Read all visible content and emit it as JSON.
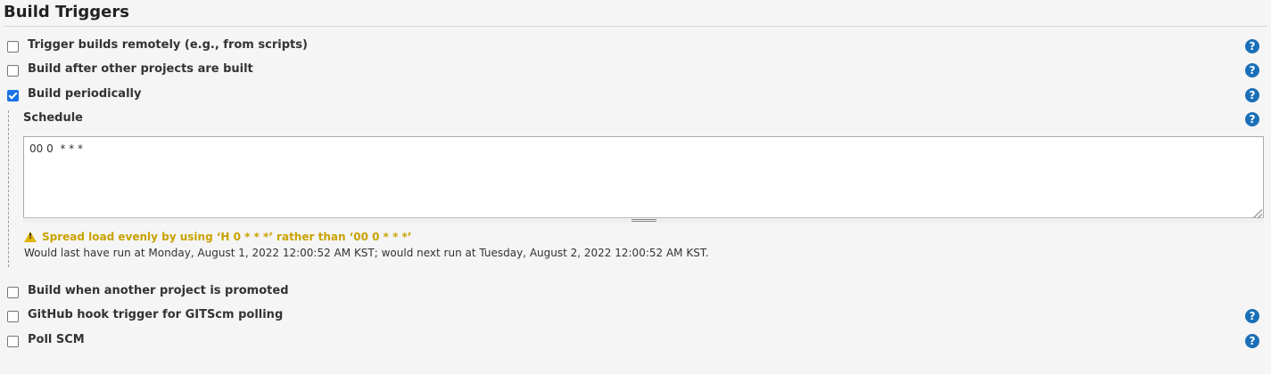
{
  "section": {
    "title": "Build Triggers"
  },
  "triggers": [
    {
      "label": "Trigger builds remotely (e.g., from scripts)",
      "checked": false,
      "help": true
    },
    {
      "label": "Build after other projects are built",
      "checked": false,
      "help": true
    },
    {
      "label": "Build periodically",
      "checked": true,
      "help": true
    },
    {
      "label": "Build when another project is promoted",
      "checked": false,
      "help": false
    },
    {
      "label": "GitHub hook trigger for GITScm polling",
      "checked": false,
      "help": true
    },
    {
      "label": "Poll SCM",
      "checked": false,
      "help": true
    }
  ],
  "schedule": {
    "label": "Schedule",
    "value": "00 0  * * *",
    "warning": "Spread load evenly by using ‘H 0  * * *’ rather than ‘00 0  * * *’",
    "note": "Would last have run at Monday, August 1, 2022 12:00:52 AM KST; would next run at Tuesday, August 2, 2022 12:00:52 AM KST."
  },
  "help_icon": {
    "glyph": "?",
    "color": "#1b6fb8"
  },
  "colors": {
    "warning": "#c9a200",
    "accent": "#1a73e8"
  }
}
